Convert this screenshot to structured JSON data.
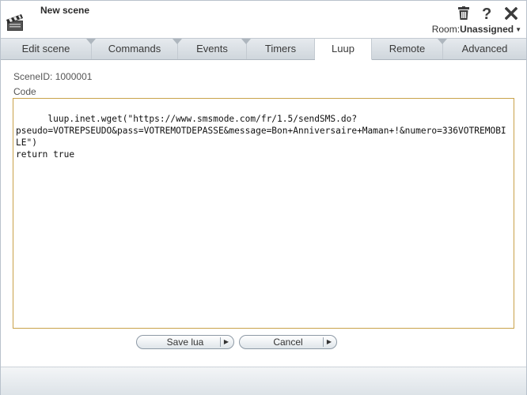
{
  "window": {
    "title": "New scene"
  },
  "header_icons": [
    "trash-icon",
    "help-icon",
    "close-icon"
  ],
  "room": {
    "label": "Room:",
    "value": "Unassigned"
  },
  "tabs": [
    {
      "label": "Edit scene",
      "active": false
    },
    {
      "label": "Commands",
      "active": false
    },
    {
      "label": "Events",
      "active": false
    },
    {
      "label": "Timers",
      "active": false
    },
    {
      "label": "Luup",
      "active": true
    },
    {
      "label": "Remote",
      "active": false
    },
    {
      "label": "Advanced",
      "active": false
    }
  ],
  "luup": {
    "scene_id": "SceneID: 1000001",
    "code_label": "Code",
    "code": "luup.inet.wget(\"https://www.smsmode.com/fr/1.5/sendSMS.do?\npseudo=VOTREPSEUDO&pass=VOTREMOTDEPASSE&message=Bon+Anniversaire+Maman+!&numero=336VOTREMOBILE\")\nreturn true"
  },
  "buttons": {
    "save": "Save lua",
    "cancel": "Cancel"
  },
  "colors": {
    "tabbar": "#d8dee3",
    "code_border": "#c9a24a",
    "frame_border": "#b9c2cc"
  }
}
